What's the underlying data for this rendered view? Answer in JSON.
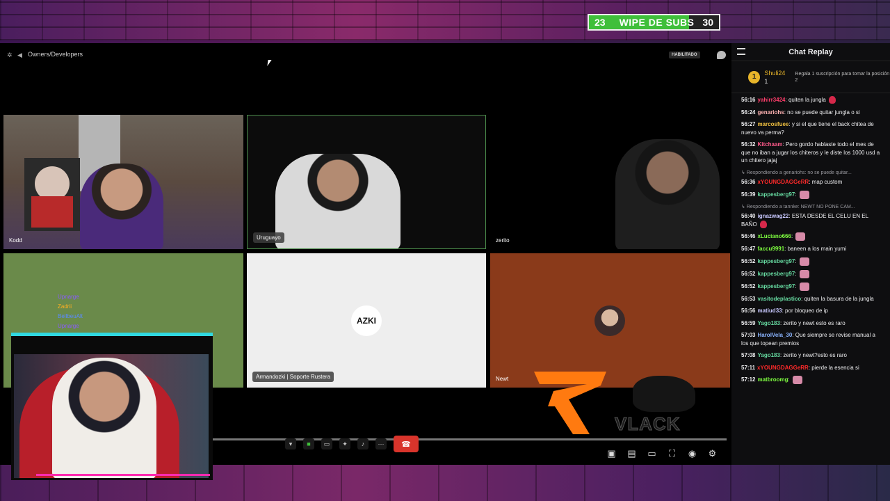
{
  "overlay": {
    "subs_goal": {
      "current": "23",
      "title": "WIPE DE SUBS",
      "target": "30",
      "progress_fraction": 0.77
    }
  },
  "call": {
    "channel_name": "Owners/Developers",
    "enabled_badge": "HABILITADO",
    "tiles": [
      {
        "label": "Kodd"
      },
      {
        "label": "Uruguayo"
      },
      {
        "label": "zerito"
      },
      {
        "label": ""
      },
      {
        "label": "Armandozki | Soporte Rustera",
        "logo_text": "AZKI"
      },
      {
        "label": "Newt"
      }
    ],
    "sub_list": [
      "Upnarge",
      "Zadrii",
      "BellbeuAlt",
      "Upnarge"
    ],
    "brand_text": "VLACK"
  },
  "chat": {
    "header": "Chat Replay",
    "pinned": {
      "rank": "1",
      "user": "Shuli24",
      "count": "1",
      "message": "Regala 1 suscripción para tomar la posición 2"
    },
    "messages": [
      {
        "time": "56:16",
        "user": "yahirr3424",
        "color": "#ff3f6c",
        "text": ": quiten la jungla",
        "emote": "heart"
      },
      {
        "time": "56:24",
        "user": "genariohs",
        "color": "#ffb3b3",
        "text": ": no se puede quitar jungla o si"
      },
      {
        "time": "56:27",
        "user": "marcosfuee",
        "color": "#f0c040",
        "text": ": y si el que tiene el back chitea de nuevo va perma?"
      },
      {
        "time": "56:32",
        "user": "Kitchaam",
        "color": "#ff5a8a",
        "text": ": Pero gordo hablaste todo el mes de que no iban a jugar los chiteros y le diste los 1000 usd a un chitero jajaj"
      },
      {
        "reply": "Respondiendo a genariohs: no se puede quitar...",
        "time": "56:36",
        "user": "xYOUNGDAGGeRR",
        "color": "#ff2a2a",
        "text": ": map custom"
      },
      {
        "time": "56:39",
        "user": "kappesberg97",
        "color": "#66d9a0",
        "text": ":",
        "emote": "emote"
      },
      {
        "reply": "Respondiendo a tannke: NEWT NO PONE CAM...",
        "time": "56:40",
        "user": "ignazwag22",
        "color": "#c8c8ff",
        "text": ": ESTA DESDE EL CELU EN EL BAÑO",
        "emote": "heart"
      },
      {
        "time": "56:46",
        "user": "xLuciano666",
        "color": "#7fff40",
        "text": ":",
        "emote": "emote"
      },
      {
        "time": "56:47",
        "user": "faccu9991",
        "color": "#7fff40",
        "text": ": baneen a los main yumi"
      },
      {
        "time": "56:52",
        "user": "kappesberg97",
        "color": "#66d9a0",
        "text": ":",
        "emote": "emote"
      },
      {
        "time": "56:52",
        "user": "kappesberg97",
        "color": "#66d9a0",
        "text": ":",
        "emote": "emote"
      },
      {
        "time": "56:52",
        "user": "kappesberg97",
        "color": "#66d9a0",
        "text": ":",
        "emote": "emote"
      },
      {
        "time": "56:53",
        "user": "vasitodeplastico",
        "color": "#66d9a0",
        "text": ": quiten la basura de la jungla"
      },
      {
        "time": "56:56",
        "user": "matiud33",
        "color": "#c8c8ff",
        "text": ": por bloqueo de ip"
      },
      {
        "time": "56:59",
        "user": "Yago183",
        "color": "#66d9a0",
        "text": ": zerito y newt esto es raro"
      },
      {
        "time": "57:03",
        "user": "HarolVela_30",
        "color": "#8ab4ff",
        "text": ": Que siempre se revise manual a los que topean premios"
      },
      {
        "time": "57:08",
        "user": "Yago183",
        "color": "#66d9a0",
        "text": ": zerito y newt?esto es raro"
      },
      {
        "time": "57:11",
        "user": "xYOUNGDAGGeRR",
        "color": "#ff2a2a",
        "text": ": pierde la esencia si"
      },
      {
        "time": "57:12",
        "user": "matbroomg",
        "color": "#7fff40",
        "text": ":",
        "emote": "emote"
      }
    ]
  }
}
